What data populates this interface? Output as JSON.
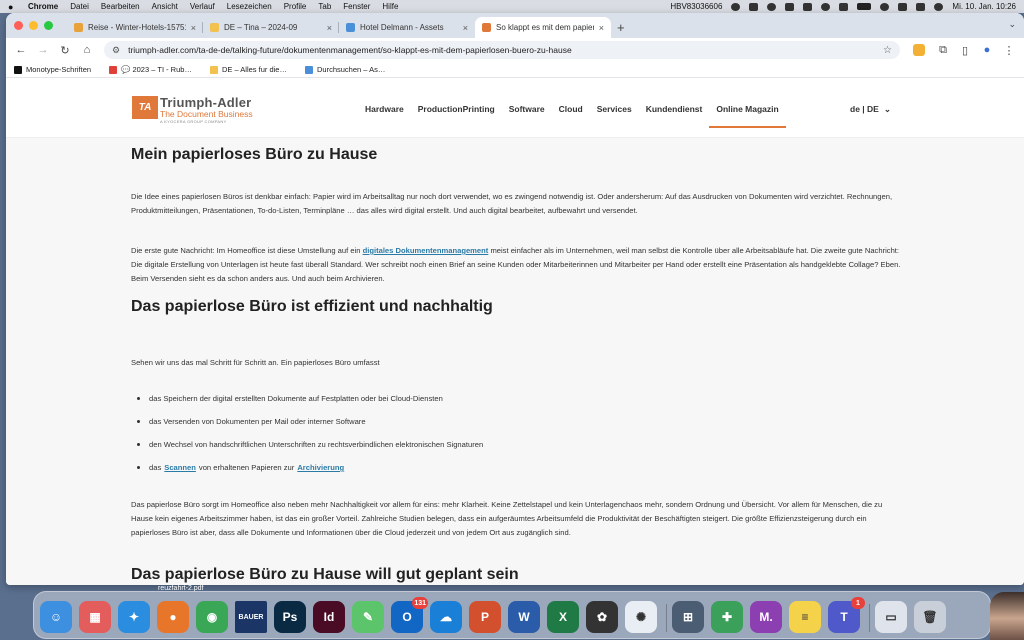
{
  "menubar": {
    "app": "Chrome",
    "items": [
      "Datei",
      "Bearbeiten",
      "Ansicht",
      "Verlauf",
      "Lesezeichen",
      "Profile",
      "Tab",
      "Fenster",
      "Hilfe"
    ],
    "device": "HBV83036606",
    "clock": "Mi. 10. Jan.  10:26"
  },
  "tabs": [
    {
      "label": "Reise - Winter-Hotels-15751…",
      "color": "#e8a23a",
      "active": false
    },
    {
      "label": "DE – Tina – 2024-09",
      "color": "#f2c14e",
      "active": false
    },
    {
      "label": "Hotel Delmann - Assets",
      "color": "#4a90d9",
      "active": false
    },
    {
      "label": "So klappt es mit dem papierlo…",
      "color": "#e0783a",
      "active": true
    }
  ],
  "omnibox": {
    "url": "triumph-adler.com/ta-de-de/talking-future/dokumentenmanagement/so-klappt-es-mit-dem-papierlosen-buero-zu-hause"
  },
  "bookmarks": [
    {
      "label": "Monotype-Schriften",
      "color": "#111111"
    },
    {
      "label": "💬 2023 – TI - Rub…",
      "color": "#e0403a"
    },
    {
      "label": "DE – Alles fur die…",
      "color": "#f2c14e"
    },
    {
      "label": "Durchsuchen – As…",
      "color": "#4a90d9"
    }
  ],
  "site": {
    "logo": {
      "mark": "TA",
      "brand": "Triumph-Adler",
      "tagline": "The Document Business",
      "small": "A KYOCERA GROUP COMPANY"
    },
    "nav": [
      "Hardware",
      "ProductionPrinting",
      "Software",
      "Cloud",
      "Services",
      "Kundendienst",
      "Online Magazin"
    ],
    "language": "de | DE",
    "accent": "#e0783a",
    "link_color": "#2b7ba7"
  },
  "article": {
    "h1": "Mein papierloses Büro zu Hause",
    "p1": "Die Idee eines papierlosen Büros ist denkbar einfach: Papier wird im Arbeitsalltag nur noch dort verwendet, wo es zwingend notwendig ist. Oder andersherum: Auf das Ausdrucken von Dokumenten wird verzichtet. Rechnungen, Produktmitteilungen, Präsentationen, To-do-Listen, Terminpläne … das alles wird digital erstellt. Und auch digital bearbeitet, aufbewahrt und versendet.",
    "p2_before": "Die erste gute Nachricht: Im Homeoffice ist diese Umstellung auf ein ",
    "p2_link": "digitales Dokumentenmanagement",
    "p2_after": " meist einfacher als im Unternehmen, weil man selbst die Kontrolle über alle Arbeitsabläufe hat. Die zweite gute Nachricht: Die digitale Erstellung von Unterlagen ist heute fast überall Standard. Wer schreibt noch einen Brief an seine Kunden oder Mitarbeiterinnen und Mitarbeiter per Hand oder erstellt eine Präsentation als handgeklebte Collage? Eben. Beim Versenden sieht es da schon anders aus. Und auch beim Archivieren.",
    "h2a": "Das papierlose Büro ist effizient und nachhaltig",
    "p3": "Sehen wir uns das mal Schritt für Schritt an. Ein papierloses Büro umfasst",
    "bullets": [
      "das Speichern der digital erstellten Dokumente auf Festplatten oder bei Cloud-Diensten",
      "das Versenden von Dokumenten per Mail oder interner Software",
      "den Wechsel von handschriftlichen Unterschriften zu rechtsverbindlichen elektronischen Signaturen"
    ],
    "bullet4": {
      "a": "das",
      "link1": "Scannen",
      "b": "von erhaltenen Papieren zur",
      "link2": "Archivierung"
    },
    "p4": "Das papierlose Büro sorgt im Homeoffice also neben mehr Nachhaltigkeit vor allem für eins: mehr Klarheit. Keine Zettelstapel und kein Unterlagenchaos mehr, sondern Ordnung und Übersicht. Vor allem für Menschen, die zu Hause kein eigenes Arbeitszimmer haben, ist das ein großer Vorteil. Zahlreiche Studien belegen, dass ein aufgeräumtes Arbeitsumfeld die Produktivität der Beschäftigten steigert. Die größte Effizienzsteigerung durch ein papierloses Büro ist aber, dass alle Dokumente und Informationen über die Cloud jederzeit und von jedem Ort aus zugänglich sind.",
    "h2b": "Das papierlose Büro zu Hause will gut geplant sein"
  },
  "dock": {
    "file_label": "reuzfahrt-2.pdf",
    "apps": [
      {
        "name": "finder-icon",
        "glyph": "☺",
        "color": "#3d8fe0"
      },
      {
        "name": "launchpad-icon",
        "glyph": "▦",
        "color": "#e45d5d"
      },
      {
        "name": "safari-icon",
        "glyph": "✦",
        "color": "#2b8de0"
      },
      {
        "name": "firefox-icon",
        "glyph": "●",
        "color": "#e8762a"
      },
      {
        "name": "chrome-icon",
        "glyph": "◉",
        "color": "#3aa757"
      },
      {
        "name": "bauer-icon",
        "glyph": "BAUER",
        "color": "#1a3566"
      },
      {
        "name": "photoshop-icon",
        "glyph": "Ps",
        "color": "#0a2a44"
      },
      {
        "name": "indesign-icon",
        "glyph": "Id",
        "color": "#4a0b24"
      },
      {
        "name": "pencil-icon",
        "glyph": "✎",
        "color": "#5cc46a"
      },
      {
        "name": "outlook-icon",
        "glyph": "O",
        "color": "#1266c4",
        "badge": "131"
      },
      {
        "name": "onedrive-icon",
        "glyph": "☁",
        "color": "#1a7fd6"
      },
      {
        "name": "powerpoint-icon",
        "glyph": "P",
        "color": "#d2502e"
      },
      {
        "name": "word-icon",
        "glyph": "W",
        "color": "#2a5caa"
      },
      {
        "name": "excel-icon",
        "glyph": "X",
        "color": "#1f7a45"
      },
      {
        "name": "palette-icon",
        "glyph": "✿",
        "color": "#333333"
      },
      {
        "name": "vectorize-icon",
        "glyph": "✺",
        "color": "#e8eef3"
      },
      {
        "name": "network-drive-icon",
        "glyph": "⊞",
        "color": "#4b5d72"
      },
      {
        "name": "vpn-icon",
        "glyph": "✚",
        "color": "#3aa05a"
      },
      {
        "name": "m-app-icon",
        "glyph": "M.",
        "color": "#8c3fb0"
      },
      {
        "name": "notes-icon",
        "glyph": "≡",
        "color": "#f4d24a"
      },
      {
        "name": "teams-icon",
        "glyph": "T",
        "color": "#5059c9",
        "badge": "1"
      },
      {
        "name": "window-preview-icon",
        "glyph": "▭",
        "color": "#dfe4ec"
      },
      {
        "name": "trash-icon",
        "glyph": "🗑",
        "color": "#c9cfd8"
      }
    ]
  }
}
